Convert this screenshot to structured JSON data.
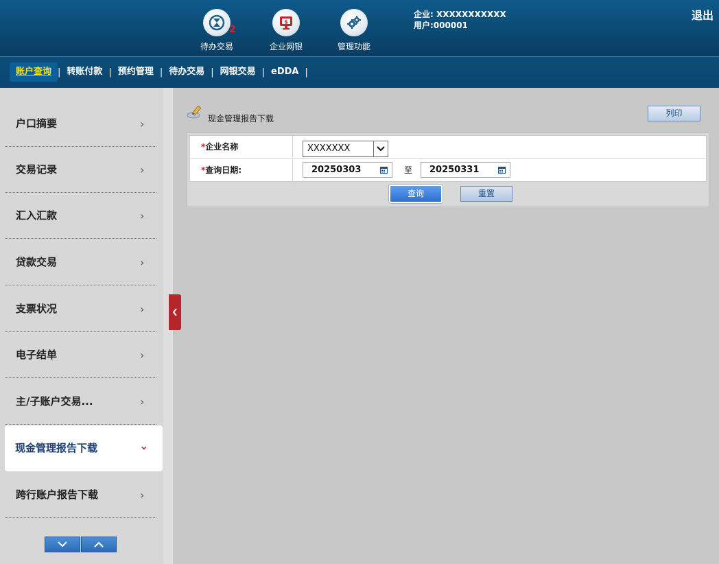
{
  "header": {
    "icons": [
      {
        "label": "待办交易",
        "icon": "clock-icon",
        "badge": "2"
      },
      {
        "label": "企业网银",
        "icon": "monitor-dollar-icon"
      },
      {
        "label": "管理功能",
        "icon": "gears-icon"
      }
    ],
    "company_line": "企业: XXXXXXXXXXX",
    "user_line": "用户:000001",
    "logout": "退出"
  },
  "nav": {
    "items": [
      "账户查询",
      "转账付款",
      "预约管理",
      "待办交易",
      "网银交易",
      "eDDA"
    ],
    "separator": "|",
    "active_index": 0
  },
  "sidebar": {
    "items": [
      {
        "label": "户口摘要"
      },
      {
        "label": "交易记录"
      },
      {
        "label": "汇入汇款"
      },
      {
        "label": "贷款交易"
      },
      {
        "label": "支票状况"
      },
      {
        "label": "电子结单"
      },
      {
        "label": "主/子账户交易..."
      },
      {
        "label": "现金管理报告下载",
        "active": true
      },
      {
        "label": "跨行账户报告下载"
      }
    ],
    "chevron_right": "›",
    "chevron_down": "⌄"
  },
  "main": {
    "title": "现金管理报告下载",
    "print_label": "列印",
    "form": {
      "company_label": "企业名称",
      "company_value": "XXXXXXX",
      "date_label": "查询日期:",
      "date_from": "20250303",
      "date_to": "20250331",
      "to_label": "至",
      "required_mark": "*"
    },
    "query_label": "查询",
    "reset_label": "重置"
  },
  "colors": {
    "header_bg": "#0b4a74",
    "active_nav_text": "#f4e21c",
    "collapse_red": "#b6252a",
    "button_blue": "#2f6dd0"
  }
}
